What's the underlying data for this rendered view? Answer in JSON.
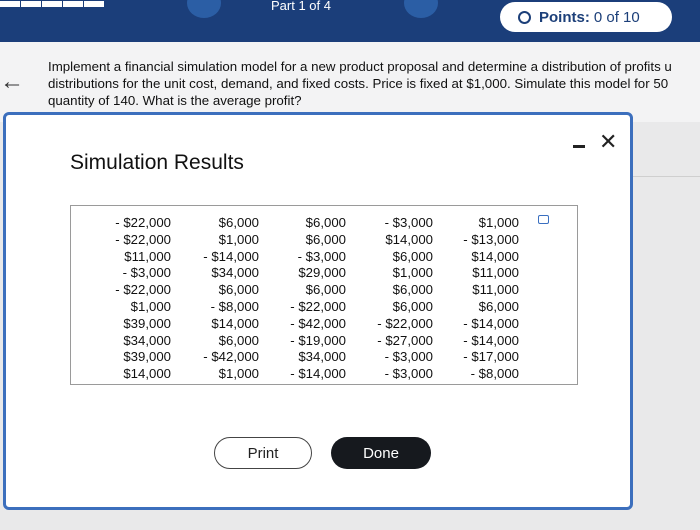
{
  "header": {
    "part_label": "Part 1 of 4",
    "points_label": "Points:",
    "points_value": "0 of 10"
  },
  "question": {
    "text": "Implement a financial simulation model for a new product proposal and determine a distribution of profits u\ndistributions for the unit cost, demand, and fixed costs. Price is fixed at $1,000. Simulate this model for 50\nquantity of 140. What is the average profit?"
  },
  "dialog": {
    "title": "Simulation Results",
    "print_label": "Print",
    "done_label": "Done",
    "columns": [
      [
        "- $22,000",
        "- $22,000",
        "$11,000",
        "- $3,000",
        "- $22,000",
        "$1,000",
        "$39,000",
        "$34,000",
        "$39,000",
        "$14,000"
      ],
      [
        "$6,000",
        "$1,000",
        "- $14,000",
        "$34,000",
        "$6,000",
        "- $8,000",
        "$14,000",
        "$6,000",
        "- $42,000",
        "$1,000"
      ],
      [
        "$6,000",
        "$6,000",
        "- $3,000",
        "$29,000",
        "$6,000",
        "- $22,000",
        "- $42,000",
        "- $19,000",
        "$34,000",
        "- $14,000"
      ],
      [
        "- $3,000",
        "$14,000",
        "$6,000",
        "$1,000",
        "$6,000",
        "$6,000",
        "- $22,000",
        "- $27,000",
        "- $3,000",
        "- $3,000"
      ],
      [
        "$1,000",
        "- $13,000",
        "$14,000",
        "$11,000",
        "$11,000",
        "$6,000",
        "- $14,000",
        "- $14,000",
        "- $17,000",
        "- $8,000"
      ]
    ]
  }
}
